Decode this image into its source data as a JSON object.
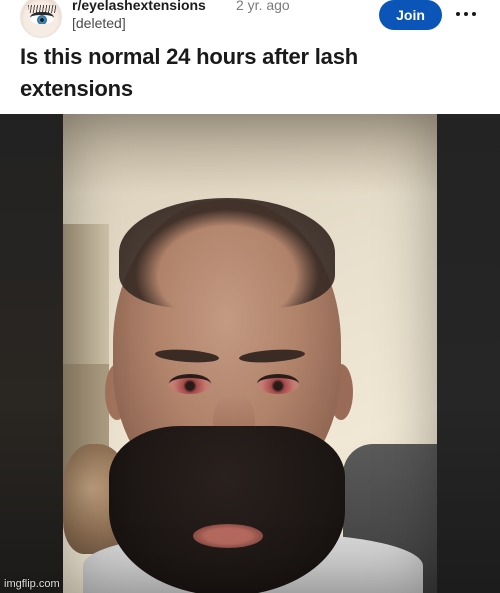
{
  "post": {
    "subreddit": "r/eyelashextensions",
    "time": "2 yr. ago",
    "author": "[deleted]",
    "join_label": "Join",
    "title": "Is this normal 24 hours after lash extensions"
  },
  "icons": {
    "avatar": "subreddit-avatar-eye",
    "more": "more-options-icon"
  },
  "colors": {
    "join_button": "#0b55b8",
    "meta_gray": "#7c7c7c"
  },
  "watermark": "imgflip.com"
}
